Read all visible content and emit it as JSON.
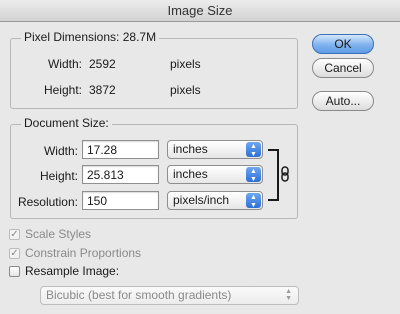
{
  "window": {
    "title": "Image Size"
  },
  "pixel_dimensions": {
    "legend": "Pixel Dimensions:",
    "size": "28.7M",
    "width_label": "Width:",
    "width_value": "2592",
    "width_unit": "pixels",
    "height_label": "Height:",
    "height_value": "3872",
    "height_unit": "pixels"
  },
  "document_size": {
    "legend": "Document Size:",
    "width_label": "Width:",
    "width_value": "17.28",
    "width_unit": "inches",
    "height_label": "Height:",
    "height_value": "25.813",
    "height_unit": "inches",
    "resolution_label": "Resolution:",
    "resolution_value": "150",
    "resolution_unit": "pixels/inch",
    "link_icon": "chain-link-icon"
  },
  "buttons": {
    "ok": "OK",
    "cancel": "Cancel",
    "auto": "Auto..."
  },
  "options": {
    "scale_styles": {
      "label": "Scale Styles",
      "checked": true,
      "enabled": false
    },
    "constrain_proportions": {
      "label": "Constrain Proportions",
      "checked": true,
      "enabled": false
    },
    "resample_image": {
      "label": "Resample Image:",
      "checked": false,
      "enabled": true
    },
    "resample_method": "Bicubic (best for smooth gradients)"
  },
  "colors": {
    "default_button": "#7fb2ee",
    "select_arrow": "#2d6fd6"
  }
}
